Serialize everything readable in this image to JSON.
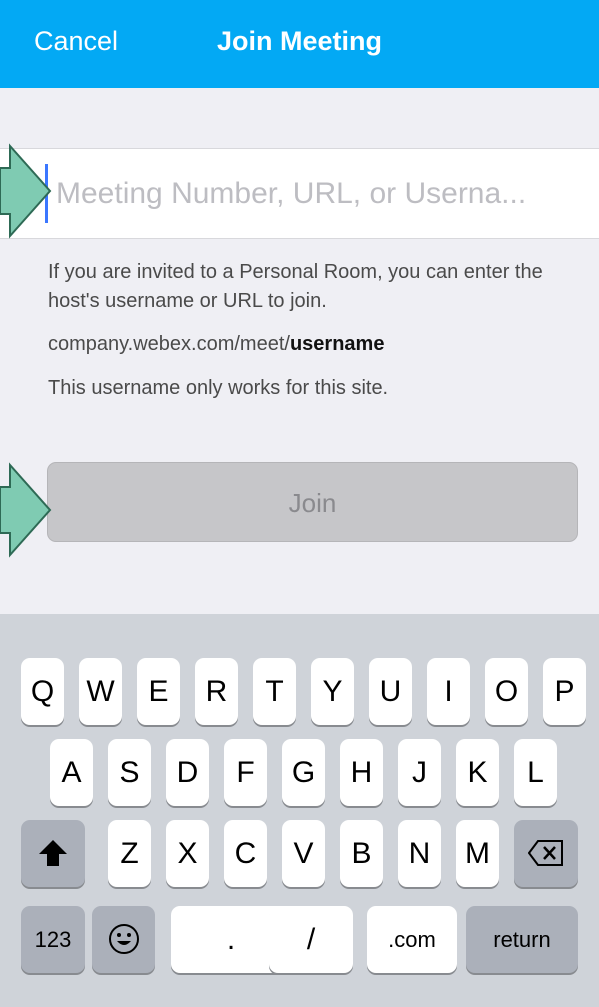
{
  "navbar": {
    "cancel": "Cancel",
    "title": "Join Meeting"
  },
  "field": {
    "placeholder": "Meeting Number, URL, or Userna..."
  },
  "help": {
    "line1": "If you are invited to a Personal Room, you can enter the host's username or URL to join.",
    "url_prefix": "company.webex.com/meet/",
    "url_bold": "username",
    "line3": "This username only works for this site."
  },
  "join": {
    "label": "Join"
  },
  "colors": {
    "accent": "#03a9f4",
    "arrow": "#7fcbb2"
  },
  "keyboard": {
    "row1": [
      "Q",
      "W",
      "E",
      "R",
      "T",
      "Y",
      "U",
      "I",
      "O",
      "P"
    ],
    "row2": [
      "A",
      "S",
      "D",
      "F",
      "G",
      "H",
      "J",
      "K",
      "L"
    ],
    "row3": [
      "Z",
      "X",
      "C",
      "V",
      "B",
      "N",
      "M"
    ],
    "shift_icon": "shift-icon",
    "backspace_icon": "backspace-icon",
    "key_123": "123",
    "emoji_icon": "emoji-icon",
    "dot": ".",
    "slash": "/",
    "dotcom": ".com",
    "return": "return"
  }
}
